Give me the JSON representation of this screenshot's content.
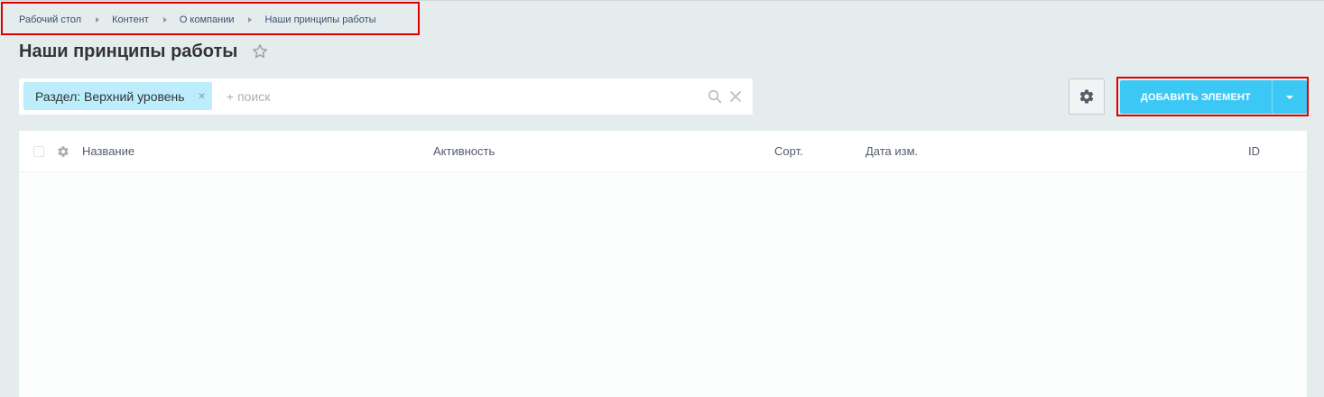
{
  "breadcrumb": {
    "items": [
      {
        "label": "Рабочий стол"
      },
      {
        "label": "Контент"
      },
      {
        "label": "О компании"
      },
      {
        "label": "Наши принципы работы"
      }
    ]
  },
  "page": {
    "title": "Наши принципы работы"
  },
  "filter": {
    "chip_label": "Раздел: Верхний уровень",
    "chip_close": "×",
    "search_placeholder": "+ поиск",
    "search_value": ""
  },
  "toolbar": {
    "add_button_label": "ДОБАВИТЬ ЭЛЕМЕНТ"
  },
  "grid": {
    "columns": [
      {
        "label": "Название"
      },
      {
        "label": "Активность"
      },
      {
        "label": "Сорт."
      },
      {
        "label": "Дата изм."
      },
      {
        "label": "ID"
      }
    ],
    "rows": []
  },
  "colors": {
    "accent": "#3bc8f5",
    "chip": "#bcedfc",
    "background": "#e5eced",
    "highlight_outline": "#e00000"
  },
  "icons": {
    "title_star": "star-icon",
    "search": "search-icon",
    "clear": "close-icon",
    "settings": "gear-icon",
    "dropdown": "chevron-down-icon",
    "column_settings": "gear-icon"
  }
}
